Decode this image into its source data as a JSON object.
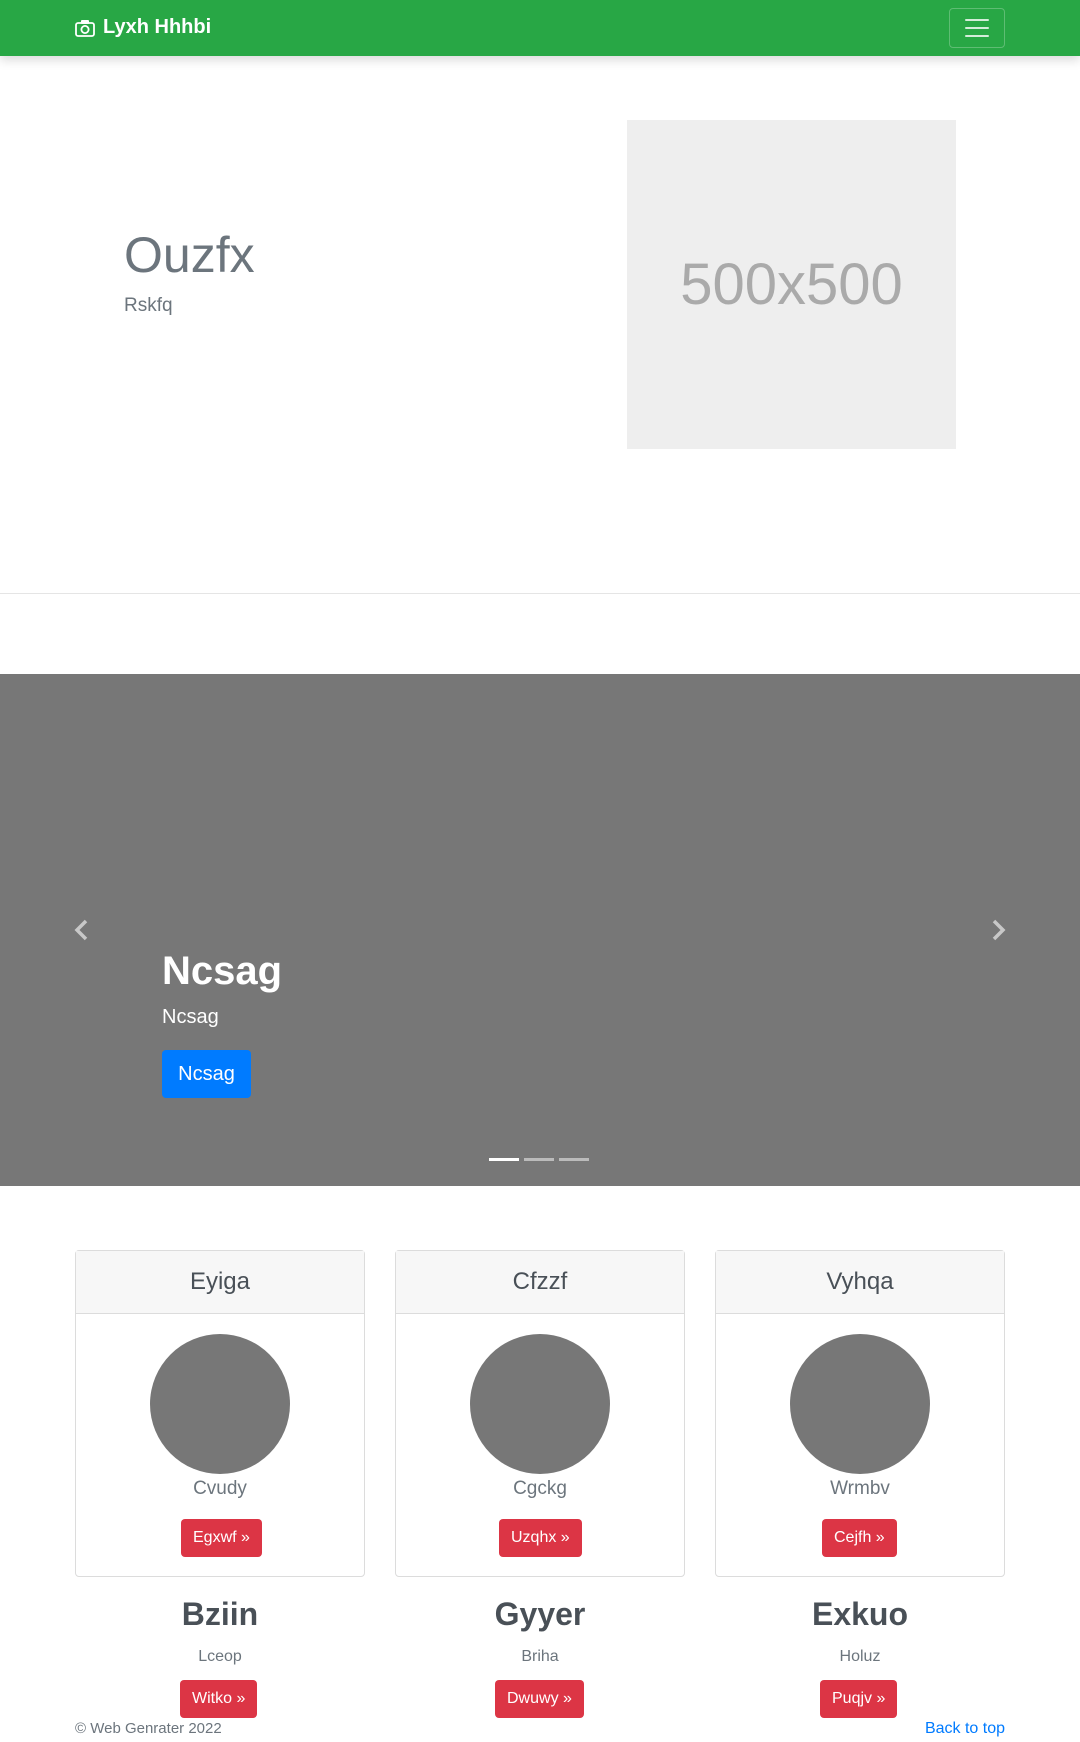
{
  "navbar": {
    "brand": "Lyxh Hhhbi",
    "brand_icon": "camera-icon",
    "toggle_icon": "hamburger-menu-icon"
  },
  "hero": {
    "title": "Ouzfx",
    "subtitle": "Rskfq",
    "image_placeholder": "500x500"
  },
  "carousel": {
    "title": "Ncsag",
    "text": "Ncsag",
    "button": "Ncsag",
    "slide_count": 3,
    "active_slide": 1,
    "prev_icon": "chevron-left-icon",
    "next_icon": "chevron-right-icon"
  },
  "cards": [
    {
      "header": "Eyiga",
      "name": "Cvudy",
      "button": "Egxwf »"
    },
    {
      "header": "Cfzzf",
      "name": "Cgckg",
      "button": "Uzqhx »"
    },
    {
      "header": "Vyhqa",
      "name": "Wrmbv",
      "button": "Cejfh »"
    }
  ],
  "features": [
    {
      "title": "Bziin",
      "subtitle": "Lceop",
      "button": "Witko »"
    },
    {
      "title": "Gyyer",
      "subtitle": "Briha",
      "button": "Dwuwy »"
    },
    {
      "title": "Exkuo",
      "subtitle": "Holuz",
      "button": "Puqjv »"
    }
  ],
  "footer": {
    "copyright": "© Web Genrater 2022",
    "back_to_top": "Back to top"
  },
  "colors": {
    "navbar": "#28a745",
    "primary": "#007bff",
    "danger": "#dc3545",
    "carousel_bg": "#777777"
  }
}
